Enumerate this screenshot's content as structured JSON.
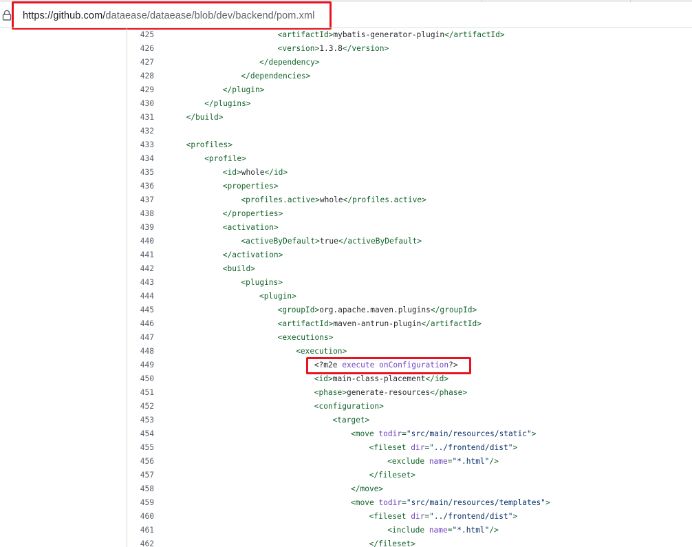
{
  "browser": {
    "url_host": "https://github.com/",
    "url_path": "dataease/dataease/blob/dev/backend/pom.xml",
    "lock_icon": "lock-icon"
  },
  "colors": {
    "highlight_box": "#e8131f",
    "xml_tag": "#116329",
    "xml_attr": "#6f42c1",
    "xml_string": "#0a3069",
    "line_number": "#57606a"
  },
  "code": {
    "file": "pom.xml",
    "lines": [
      {
        "n": "425",
        "indent": 6,
        "tokens": [
          [
            "tag",
            "<artifactId>"
          ],
          [
            "txt",
            "mybatis-generator-plugin"
          ],
          [
            "tag",
            "</artifactId>"
          ]
        ]
      },
      {
        "n": "426",
        "indent": 6,
        "tokens": [
          [
            "tag",
            "<version>"
          ],
          [
            "txt",
            "1.3.8"
          ],
          [
            "tag",
            "</version>"
          ]
        ]
      },
      {
        "n": "427",
        "indent": 5,
        "tokens": [
          [
            "tag",
            "</dependency>"
          ]
        ]
      },
      {
        "n": "428",
        "indent": 4,
        "tokens": [
          [
            "tag",
            "</dependencies>"
          ]
        ]
      },
      {
        "n": "429",
        "indent": 3,
        "tokens": [
          [
            "tag",
            "</plugin>"
          ]
        ]
      },
      {
        "n": "430",
        "indent": 2,
        "tokens": [
          [
            "tag",
            "</plugins>"
          ]
        ]
      },
      {
        "n": "431",
        "indent": 1,
        "tokens": [
          [
            "tag",
            "</build>"
          ]
        ]
      },
      {
        "n": "432",
        "indent": 0,
        "tokens": []
      },
      {
        "n": "433",
        "indent": 1,
        "tokens": [
          [
            "tag",
            "<profiles>"
          ]
        ]
      },
      {
        "n": "434",
        "indent": 2,
        "tokens": [
          [
            "tag",
            "<profile>"
          ]
        ]
      },
      {
        "n": "435",
        "indent": 3,
        "tokens": [
          [
            "tag",
            "<id>"
          ],
          [
            "txt",
            "whole"
          ],
          [
            "tag",
            "</id>"
          ]
        ]
      },
      {
        "n": "436",
        "indent": 3,
        "tokens": [
          [
            "tag",
            "<properties>"
          ]
        ]
      },
      {
        "n": "437",
        "indent": 4,
        "tokens": [
          [
            "tag",
            "<profiles.active>"
          ],
          [
            "txt",
            "whole"
          ],
          [
            "tag",
            "</profiles.active>"
          ]
        ]
      },
      {
        "n": "438",
        "indent": 3,
        "tokens": [
          [
            "tag",
            "</properties>"
          ]
        ]
      },
      {
        "n": "439",
        "indent": 3,
        "tokens": [
          [
            "tag",
            "<activation>"
          ]
        ]
      },
      {
        "n": "440",
        "indent": 4,
        "tokens": [
          [
            "tag",
            "<activeByDefault>"
          ],
          [
            "txt",
            "true"
          ],
          [
            "tag",
            "</activeByDefault>"
          ]
        ]
      },
      {
        "n": "441",
        "indent": 3,
        "tokens": [
          [
            "tag",
            "</activation>"
          ]
        ]
      },
      {
        "n": "442",
        "indent": 3,
        "tokens": [
          [
            "tag",
            "<build>"
          ]
        ]
      },
      {
        "n": "443",
        "indent": 4,
        "tokens": [
          [
            "tag",
            "<plugins>"
          ]
        ]
      },
      {
        "n": "444",
        "indent": 5,
        "tokens": [
          [
            "tag",
            "<plugin>"
          ]
        ]
      },
      {
        "n": "445",
        "indent": 6,
        "tokens": [
          [
            "tag",
            "<groupId>"
          ],
          [
            "txt",
            "org.apache.maven.plugins"
          ],
          [
            "tag",
            "</groupId>"
          ]
        ]
      },
      {
        "n": "446",
        "indent": 6,
        "tokens": [
          [
            "tag",
            "<artifactId>"
          ],
          [
            "txt",
            "maven-antrun-plugin"
          ],
          [
            "tag",
            "</artifactId>"
          ]
        ]
      },
      {
        "n": "447",
        "indent": 6,
        "tokens": [
          [
            "tag",
            "<executions>"
          ]
        ]
      },
      {
        "n": "448",
        "indent": 7,
        "tokens": [
          [
            "tag",
            "<execution>"
          ]
        ]
      },
      {
        "n": "449",
        "indent": 8,
        "highlight": true,
        "tokens": [
          [
            "pi",
            "<?m2e "
          ],
          [
            "attr",
            "execute"
          ],
          [
            "pi",
            " "
          ],
          [
            "attr",
            "onConfiguration"
          ],
          [
            "pi",
            "?>"
          ]
        ]
      },
      {
        "n": "450",
        "indent": 8,
        "tokens": [
          [
            "tag",
            "<id>"
          ],
          [
            "txt",
            "main-class-placement"
          ],
          [
            "tag",
            "</id>"
          ]
        ]
      },
      {
        "n": "451",
        "indent": 8,
        "tokens": [
          [
            "tag",
            "<phase>"
          ],
          [
            "txt",
            "generate-resources"
          ],
          [
            "tag",
            "</phase>"
          ]
        ]
      },
      {
        "n": "452",
        "indent": 8,
        "tokens": [
          [
            "tag",
            "<configuration>"
          ]
        ]
      },
      {
        "n": "453",
        "indent": 9,
        "tokens": [
          [
            "tag",
            "<target>"
          ]
        ]
      },
      {
        "n": "454",
        "indent": 10,
        "tokens": [
          [
            "tag",
            "<move "
          ],
          [
            "attr",
            "todir"
          ],
          [
            "tag",
            "="
          ],
          [
            "str",
            "\"src/main/resources/static\""
          ],
          [
            "tag",
            ">"
          ]
        ]
      },
      {
        "n": "455",
        "indent": 11,
        "tokens": [
          [
            "tag",
            "<fileset "
          ],
          [
            "attr",
            "dir"
          ],
          [
            "tag",
            "="
          ],
          [
            "str",
            "\"../frontend/dist\""
          ],
          [
            "tag",
            ">"
          ]
        ]
      },
      {
        "n": "456",
        "indent": 12,
        "tokens": [
          [
            "tag",
            "<exclude "
          ],
          [
            "attr",
            "name"
          ],
          [
            "tag",
            "="
          ],
          [
            "str",
            "\"*.html\""
          ],
          [
            "tag",
            "/>"
          ]
        ]
      },
      {
        "n": "457",
        "indent": 11,
        "tokens": [
          [
            "tag",
            "</fileset>"
          ]
        ]
      },
      {
        "n": "458",
        "indent": 10,
        "tokens": [
          [
            "tag",
            "</move>"
          ]
        ]
      },
      {
        "n": "459",
        "indent": 10,
        "tokens": [
          [
            "tag",
            "<move "
          ],
          [
            "attr",
            "todir"
          ],
          [
            "tag",
            "="
          ],
          [
            "str",
            "\"src/main/resources/templates\""
          ],
          [
            "tag",
            ">"
          ]
        ]
      },
      {
        "n": "460",
        "indent": 11,
        "tokens": [
          [
            "tag",
            "<fileset "
          ],
          [
            "attr",
            "dir"
          ],
          [
            "tag",
            "="
          ],
          [
            "str",
            "\"../frontend/dist\""
          ],
          [
            "tag",
            ">"
          ]
        ]
      },
      {
        "n": "461",
        "indent": 12,
        "tokens": [
          [
            "tag",
            "<include "
          ],
          [
            "attr",
            "name"
          ],
          [
            "tag",
            "="
          ],
          [
            "str",
            "\"*.html\""
          ],
          [
            "tag",
            "/>"
          ]
        ]
      },
      {
        "n": "462",
        "indent": 11,
        "tokens": [
          [
            "tag",
            "</fileset>"
          ]
        ]
      }
    ]
  }
}
